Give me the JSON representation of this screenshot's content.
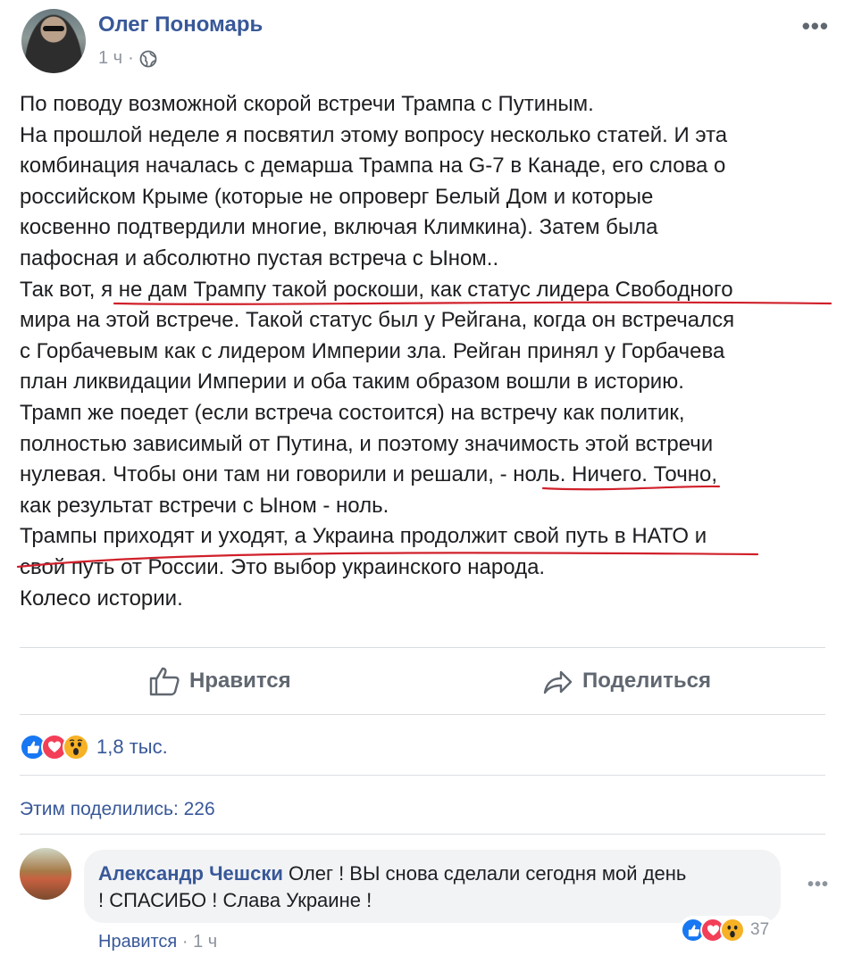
{
  "post": {
    "author": "Олег Пономарь",
    "time": "1 ч",
    "separator": "·",
    "more_label": "•••",
    "lines": [
      "По поводу возможной скорой встречи Трампа с Путиным.",
      "На прошлой неделе я посвятил этому вопросу несколько статей. И эта",
      "комбинация началась с демарша Трампа на G-7 в Канаде, его слова о",
      "российском Крыме (которые не опроверг Белый Дом и которые",
      "косвенно подтвердили многие, включая Климкина). Затем была",
      "пафосная и абсолютно пустая встреча с Ыном..",
      "Так вот, я не дам Трампу такой роскоши, как статус лидера Свободного",
      "мира на этой встрече. Такой статус был у Рейгана, когда он встречался",
      "с Горбачевым как с лидером Империи зла. Рейган принял у Горбачева",
      "план ликвидации Империи и оба таким образом вошли в историю.",
      "Трамп же поедет (если встреча состоится) на встречу как политик,",
      "полностью зависимый от Путина, и поэтому значимость этой встречи",
      "нулевая. Чтобы они там ни говорили и решали, - ноль. Ничего. Точно,",
      "как результат встречи с Ыном - ноль.",
      "Трампы приходят и уходят, а Украина продолжит свой путь в НАТО и",
      "свой путь от России. Это выбор украинского народа.",
      "Колесо истории."
    ],
    "underline_color": "#d0202a"
  },
  "actions": {
    "like_label": "Нравится",
    "share_label": "Поделиться"
  },
  "reactions": {
    "icons": [
      "like-icon",
      "love-icon",
      "wow-icon"
    ],
    "count": "1,8 тыс."
  },
  "shares": "Этим поделились: 226",
  "comment": {
    "author": "Александр Чешски",
    "text_line1": "Олег ! ВЫ снова сделали сегодня мой день",
    "text_line2": "! СПАСИБО ! Слава Украине !",
    "reaction_count": "37",
    "like_label": "Нравится",
    "separator": "·",
    "time": "1 ч",
    "more_label": "•••"
  },
  "colors": {
    "link": "#385898",
    "muted": "#8d949e",
    "like": "#1877f2",
    "love": "#f33e58",
    "wow": "#f7b125"
  }
}
